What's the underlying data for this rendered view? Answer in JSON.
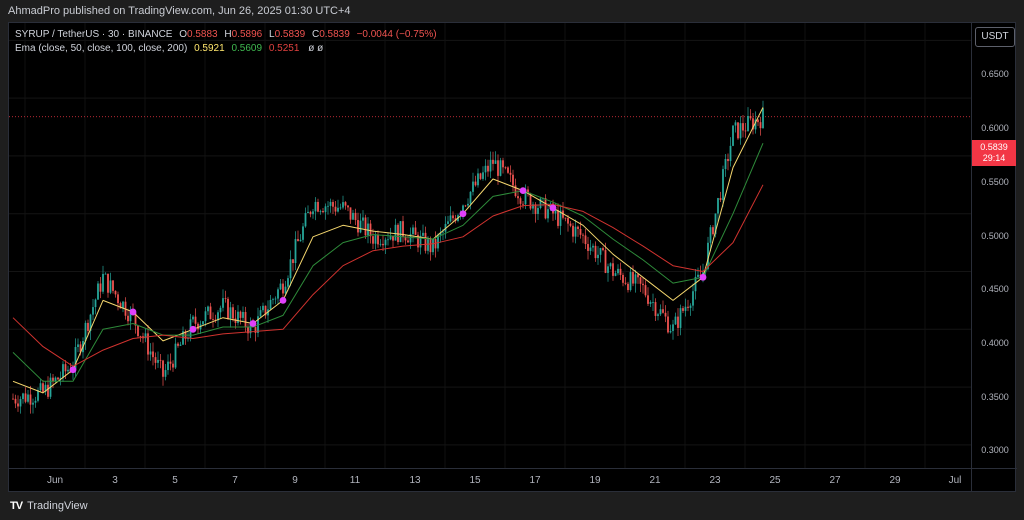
{
  "header": {
    "published": "AhmadPro published on TradingView.com, Jun 26, 2025 01:30 UTC+4"
  },
  "legend": {
    "symbol": "SYRUP / TetherUS · 30 · BINANCE",
    "o_label": "O",
    "o": "0.5883",
    "h_label": "H",
    "h": "0.5896",
    "l_label": "L",
    "l": "0.5839",
    "c_label": "C",
    "c": "0.5839",
    "change": "−0.0044 (−0.75%)",
    "ema_label": "Ema (close, 50, close, 100, close, 200)",
    "ema_vals": [
      "0.5921",
      "0.5609",
      "0.5251"
    ],
    "flags": "ø  ø"
  },
  "currency_button": "USDT",
  "price_axis": {
    "min": 0.28,
    "max": 0.665,
    "ticks": [
      "0.6500",
      "0.6000",
      "0.5500",
      "0.5000",
      "0.4500",
      "0.4000",
      "0.3500",
      "0.3000"
    ],
    "last_price": "0.5839",
    "countdown": "29:14"
  },
  "time_axis": {
    "labels": [
      "Jun",
      "3",
      "5",
      "7",
      "9",
      "11",
      "13",
      "15",
      "17",
      "19",
      "21",
      "23",
      "25",
      "27",
      "29",
      "Jul"
    ]
  },
  "chart_data": {
    "type": "line",
    "x": [
      "Jun 1",
      "Jun 2",
      "Jun 3",
      "Jun 4",
      "Jun 5",
      "Jun 6",
      "Jun 7",
      "Jun 8",
      "Jun 9",
      "Jun 10",
      "Jun 11",
      "Jun 12",
      "Jun 13",
      "Jun 14",
      "Jun 15",
      "Jun 16",
      "Jun 17",
      "Jun 18",
      "Jun 19",
      "Jun 20",
      "Jun 21",
      "Jun 22",
      "Jun 23",
      "Jun 24",
      "Jun 25",
      "Jun 26"
    ],
    "series": [
      {
        "name": "Price",
        "values": [
          0.34,
          0.345,
          0.37,
          0.445,
          0.41,
          0.36,
          0.405,
          0.42,
          0.4,
          0.44,
          0.51,
          0.505,
          0.48,
          0.485,
          0.47,
          0.51,
          0.545,
          0.515,
          0.5,
          0.48,
          0.45,
          0.435,
          0.4,
          0.45,
          0.57,
          0.584
        ]
      },
      {
        "name": "EMA 50",
        "values": [
          0.355,
          0.345,
          0.365,
          0.425,
          0.415,
          0.39,
          0.4,
          0.41,
          0.405,
          0.425,
          0.48,
          0.49,
          0.485,
          0.482,
          0.478,
          0.5,
          0.53,
          0.52,
          0.505,
          0.49,
          0.465,
          0.445,
          0.425,
          0.445,
          0.54,
          0.592
        ]
      },
      {
        "name": "EMA 100",
        "values": [
          0.38,
          0.355,
          0.355,
          0.4,
          0.405,
          0.395,
          0.395,
          0.402,
          0.402,
          0.412,
          0.455,
          0.475,
          0.482,
          0.48,
          0.478,
          0.49,
          0.515,
          0.52,
          0.51,
          0.498,
          0.478,
          0.46,
          0.44,
          0.445,
          0.5,
          0.561
        ]
      },
      {
        "name": "EMA 200",
        "values": [
          0.41,
          0.385,
          0.368,
          0.382,
          0.392,
          0.395,
          0.392,
          0.396,
          0.398,
          0.4,
          0.43,
          0.455,
          0.468,
          0.472,
          0.474,
          0.48,
          0.498,
          0.507,
          0.508,
          0.502,
          0.488,
          0.472,
          0.455,
          0.45,
          0.475,
          0.525
        ]
      }
    ],
    "crossover_markers_at": [
      "Jun 3",
      "Jun 5",
      "Jun 7",
      "Jun 9",
      "Jun 10",
      "Jun 16",
      "Jun 18",
      "Jun 19",
      "Jun 24"
    ],
    "ylim": [
      0.28,
      0.665
    ],
    "legend": "top-left"
  },
  "colors": {
    "price": "#26a69a",
    "ema50": "#f5d76e",
    "ema100": "#2e8b3a",
    "ema200": "#d0332f",
    "markers": "#e040fb",
    "last_price": "#f23645"
  },
  "footer": {
    "brand": "TradingView"
  }
}
